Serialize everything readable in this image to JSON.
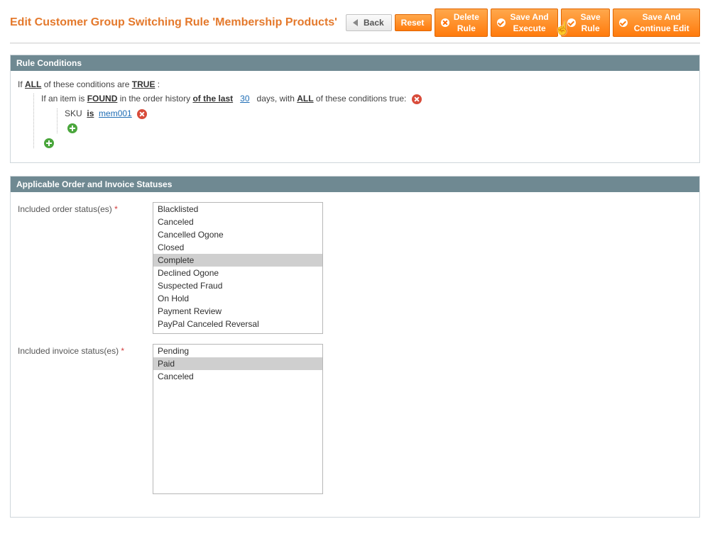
{
  "header": {
    "title": "Edit Customer Group Switching Rule 'Membership Products'",
    "buttons": {
      "back": "Back",
      "reset": "Reset",
      "delete": "Delete Rule",
      "save_execute": "Save And Execute",
      "save": "Save Rule",
      "save_continue": "Save And Continue Edit"
    }
  },
  "sections": {
    "conditions": {
      "title": "Rule Conditions",
      "root_prefix": "If",
      "root_aggregator": "ALL",
      "root_mid": "of these conditions are",
      "root_value": "TRUE",
      "order_prefix": "If an item is",
      "order_found": "FOUND",
      "order_mid1": "in the order history",
      "order_period_label": "of the last",
      "order_period_days": "30",
      "order_days_word": "days, with",
      "order_aggregator": "ALL",
      "order_suffix": "of these conditions true:",
      "sku_attr": "SKU",
      "sku_op": "is",
      "sku_value": "mem001"
    },
    "statuses": {
      "title": "Applicable Order and Invoice Statuses",
      "order_label": "Included order status(es)",
      "invoice_label": "Included invoice status(es)",
      "order_options": [
        {
          "label": "Blacklisted",
          "selected": false
        },
        {
          "label": "Canceled",
          "selected": false
        },
        {
          "label": "Cancelled Ogone",
          "selected": false
        },
        {
          "label": "Closed",
          "selected": false
        },
        {
          "label": "Complete",
          "selected": true
        },
        {
          "label": "Declined Ogone",
          "selected": false
        },
        {
          "label": "Suspected Fraud",
          "selected": false
        },
        {
          "label": "On Hold",
          "selected": false
        },
        {
          "label": "Payment Review",
          "selected": false
        },
        {
          "label": "PayPal Canceled Reversal",
          "selected": false
        }
      ],
      "invoice_options": [
        {
          "label": "Pending",
          "selected": false
        },
        {
          "label": "Paid",
          "selected": true
        },
        {
          "label": "Canceled",
          "selected": false
        }
      ]
    }
  }
}
